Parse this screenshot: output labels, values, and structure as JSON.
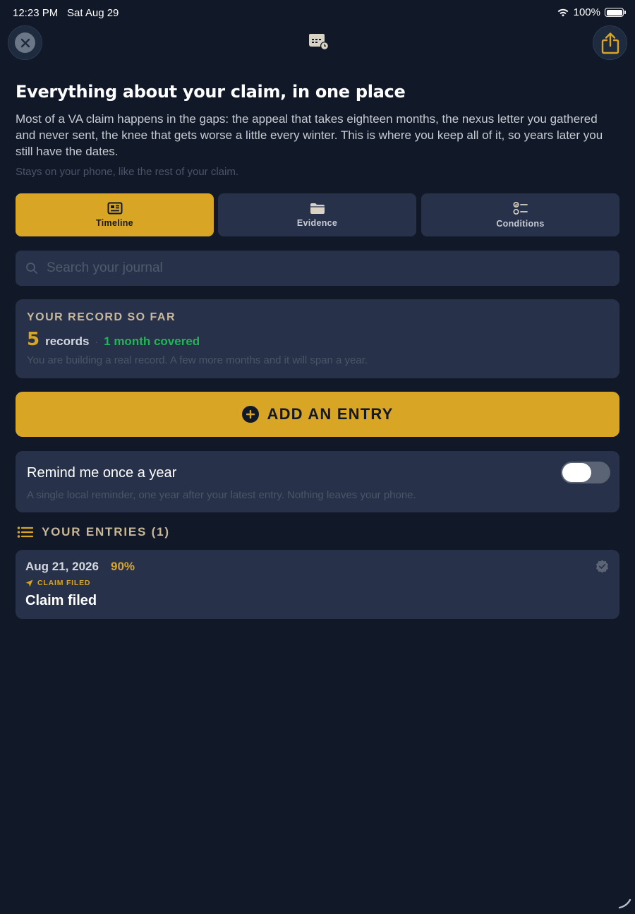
{
  "status_bar": {
    "time": "12:23 PM",
    "date": "Sat Aug 29",
    "battery": "100%"
  },
  "header": {
    "close_icon": "close-icon",
    "center_icon": "calendar-icon",
    "share_icon": "share-icon"
  },
  "intro": {
    "title": "Everything about your claim, in one place",
    "body": "Most of a VA claim happens in the gaps: the appeal that takes eighteen months, the nexus letter you gathered and never sent, the knee that gets worse a little every winter. This is where you keep all of it, so years later you still have the dates.",
    "note": "Stays on your phone, like the rest of your claim."
  },
  "tabs": [
    {
      "label": "Timeline",
      "icon": "newspaper-icon",
      "active": true
    },
    {
      "label": "Evidence",
      "icon": "folder-icon",
      "active": false
    },
    {
      "label": "Conditions",
      "icon": "checklist-icon",
      "active": false
    }
  ],
  "search": {
    "placeholder": "Search your journal",
    "value": ""
  },
  "record": {
    "heading": "YOUR RECORD SO FAR",
    "count": "5",
    "count_label": "records",
    "separator": "·",
    "covered": "1 month covered",
    "note": "You are building a real record. A few more months and it will span a year."
  },
  "add_entry": {
    "label": "ADD AN ENTRY"
  },
  "reminder": {
    "title": "Remind me once a year",
    "note": "A single local reminder, one year after your latest entry. Nothing leaves your phone.",
    "enabled": false
  },
  "entries": {
    "heading": "YOUR ENTRIES (1)",
    "items": [
      {
        "date": "Aug 21, 2026",
        "percent": "90%",
        "type": "CLAIM FILED",
        "title": "Claim filed"
      }
    ]
  },
  "colors": {
    "background": "#111827",
    "card": "#27324a",
    "accent": "#d8a624",
    "success": "#22b557"
  }
}
